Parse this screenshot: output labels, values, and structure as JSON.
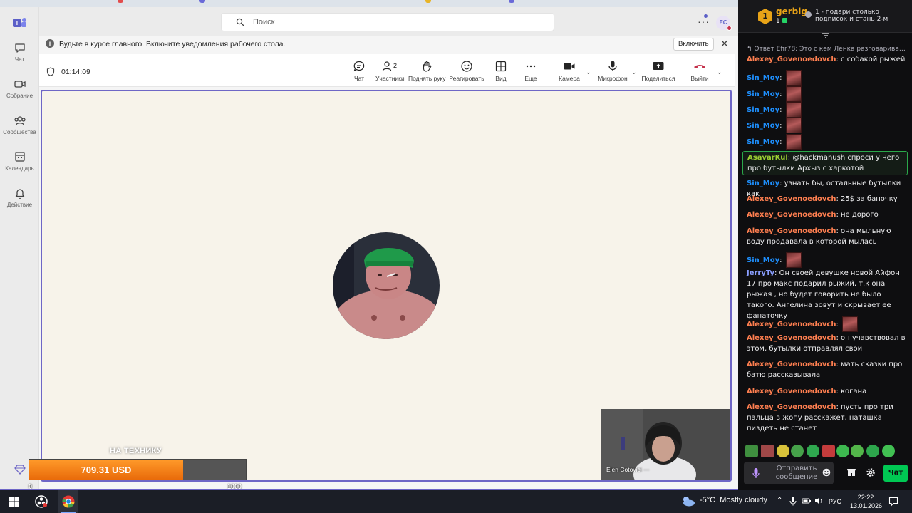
{
  "teams": {
    "search": {
      "placeholder": "Поиск"
    },
    "avatar_initials": "EC",
    "rail": [
      {
        "key": "chat",
        "label": "Чат"
      },
      {
        "key": "meetings",
        "label": "Собрание"
      },
      {
        "key": "communities",
        "label": "Сообщества"
      },
      {
        "key": "calendar",
        "label": "Календарь"
      },
      {
        "key": "activity",
        "label": "Действие"
      }
    ],
    "banner": {
      "text": "Будьте в курсе главного. Включите уведомления рабочего стола.",
      "button": "Включить"
    },
    "call": {
      "timer": "01:14:09",
      "participants_count": "2",
      "controls": {
        "chat": "Чат",
        "participants": "Участники",
        "raise_hand": "Поднять руку",
        "react": "Реагировать",
        "view": "Вид",
        "more": "Еще",
        "camera": "Камера",
        "mic": "Микрофон",
        "share": "Поделиться",
        "leave": "Выйти"
      },
      "self_view_name": "Elen Cotovici ⋯"
    },
    "accent": "#6e66c6"
  },
  "donation": {
    "label": "НА ТЕХНИКУ",
    "amount": "709.31 USD",
    "min": "0",
    "max": "1000",
    "progress_fraction": 0.709
  },
  "chat": {
    "top_gifter": {
      "rank": "1",
      "name": "gerbig",
      "count": "1"
    },
    "gift_text": "1 - подари столько подписок и стань 2-м",
    "reply_text": "Ответ Efir78: Это с кем Ленка разговаривает...",
    "messages": [
      {
        "user": "Alexey_Govenoedovch",
        "color": "#ff7f50",
        "text": "с собакой рыжей",
        "emote": false
      },
      {
        "user": "Sin_Moy",
        "color": "#1e90ff",
        "text": "",
        "emote": true
      },
      {
        "user": "Sin_Moy",
        "color": "#1e90ff",
        "text": "",
        "emote": true
      },
      {
        "user": "Sin_Moy",
        "color": "#1e90ff",
        "text": "",
        "emote": true
      },
      {
        "user": "Sin_Moy",
        "color": "#1e90ff",
        "text": "",
        "emote": true
      },
      {
        "user": "Sin_Moy",
        "color": "#1e90ff",
        "text": "",
        "emote": true
      },
      {
        "user": "AsavarKul",
        "color": "#9acd32",
        "text": "@hackmanush спроси у него про бутылки Архыз с харкотой",
        "emote": false,
        "highlight": true
      },
      {
        "user": "Sin_Moy",
        "color": "#1e90ff",
        "text": "узнать бы, остальные бутылки как",
        "emote": false
      },
      {
        "user": "Alexey_Govenoedovch",
        "color": "#ff7f50",
        "text": "25$ за баночку",
        "emote": false
      },
      {
        "user": "Alexey_Govenoedovch",
        "color": "#ff7f50",
        "text": "не дорого",
        "emote": false
      },
      {
        "user": "Alexey_Govenoedovch",
        "color": "#ff7f50",
        "text": "она мыльную воду продавала в которой мылась",
        "emote": false
      },
      {
        "user": "Sin_Moy",
        "color": "#1e90ff",
        "text": "",
        "emote": true
      },
      {
        "user": "JerryTy",
        "color": "#8a9eff",
        "text": "Он своей девушке новой Айфон 17 про макс подарил рыжий, т.к она рыжая , но будет говорить не было такого. Ангелина зовут и скрывает ее фанаточку",
        "emote": false
      },
      {
        "user": "Alexey_Govenoedovch",
        "color": "#ff7f50",
        "text": "",
        "emote": true
      },
      {
        "user": "Alexey_Govenoedovch",
        "color": "#ff7f50",
        "text": "он учавствовал в этом, бутылки отправлял свои",
        "emote": false
      },
      {
        "user": "Alexey_Govenoedovch",
        "color": "#ff7f50",
        "text": "мать сказки про батю рассказывала",
        "emote": false
      },
      {
        "user": "Alexey_Govenoedovch",
        "color": "#ff7f50",
        "text": "когана",
        "emote": false
      },
      {
        "user": "Alexey_Govenoedovch",
        "color": "#ff7f50",
        "text": "пусть про три пальца в жопу расскажет, наташка пиздеть не станет",
        "emote": false
      }
    ],
    "input_placeholder": "Отправить сообщение",
    "chat_button": "Чат",
    "accent": "#00c853"
  },
  "taskbar": {
    "weather_temp": "-5°C",
    "weather_text": "Mostly cloudy",
    "lang": "РУС",
    "time": "22:22",
    "date": "13.01.2026"
  }
}
